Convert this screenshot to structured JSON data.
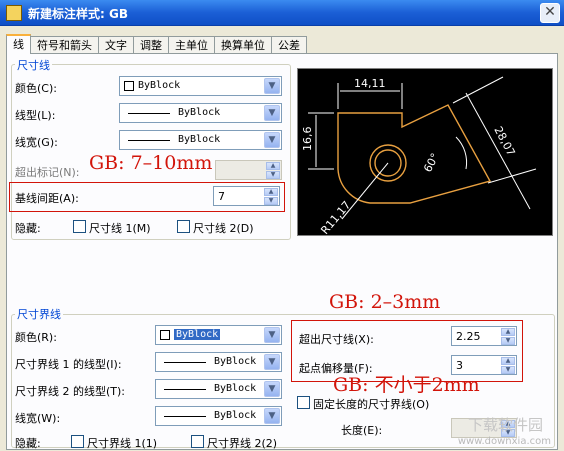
{
  "window": {
    "title": "新建标注样式: GB",
    "close_glyph": "✕"
  },
  "tabs": [
    "线",
    "符号和箭头",
    "文字",
    "调整",
    "主单位",
    "换算单位",
    "公差"
  ],
  "dim_line": {
    "group_title": "尺寸线",
    "color_label": "颜色(C):",
    "color_value": "ByBlock",
    "linetype_label": "线型(L):",
    "linetype_value": "ByBlock",
    "lineweight_label": "线宽(G):",
    "lineweight_value": "ByBlock",
    "extend_label": "超出标记(N):",
    "baseline_label": "基线间距(A):",
    "baseline_value": "7",
    "suppress_label": "隐藏:",
    "dimline1_label": "尺寸线 1(M)",
    "dimline2_label": "尺寸线 2(D)"
  },
  "preview": {
    "dim_top": "14,11",
    "dim_left": "16,6",
    "dim_right": "28,07",
    "dim_angle": "60°",
    "dim_radius": "R11,17"
  },
  "ext_line": {
    "group_title": "尺寸界线",
    "color_label": "颜色(R):",
    "color_value": "ByBlock",
    "ext1_label": "尺寸界线 1 的线型(I):",
    "ext1_value": "ByBlock",
    "ext2_label": "尺寸界线 2 的线型(T):",
    "ext2_value": "ByBlock",
    "lineweight_label": "线宽(W):",
    "lineweight_value": "ByBlock",
    "suppress_label": "隐藏:",
    "ext1_check": "尺寸界线 1(1)",
    "ext2_check": "尺寸界线 2(2)",
    "beyond_label": "超出尺寸线(X):",
    "beyond_value": "2.25",
    "offset_label": "起点偏移量(F):",
    "offset_value": "3",
    "fixed_label": "固定长度的尺寸界线(O)",
    "length_label": "长度(E):"
  },
  "annotations": {
    "baseline_note": "GB: 7–10mm",
    "beyond_note": "GB: 2–3mm",
    "offset_note": "GB: 不小于2mm"
  },
  "watermark": {
    "brand": "下载软件园",
    "site": "www.downxia.com"
  },
  "colors": {
    "annotation_red": "#d2140a",
    "group_title_blue": "#0046d5",
    "preview_geometry": "#e8a040"
  }
}
